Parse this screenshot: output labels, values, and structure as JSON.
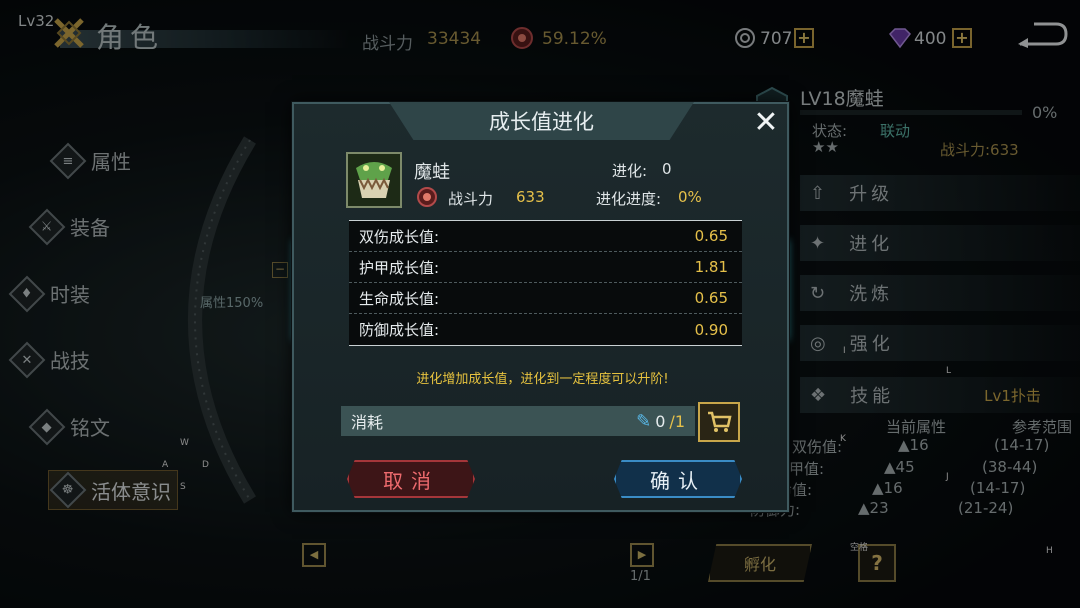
{
  "header": {
    "level": "Lv32",
    "title": "角色",
    "power_label": "战斗力",
    "power_value": "33434",
    "ratio_value": "59.12%",
    "coins": "707",
    "gems": "400",
    "plus_symbol": "+"
  },
  "left_menu": {
    "items": [
      {
        "label": "属性",
        "icon": "list-icon"
      },
      {
        "label": "装备",
        "icon": "sword-icon"
      },
      {
        "label": "时装",
        "icon": "outfit-icon"
      },
      {
        "label": "战技",
        "icon": "cross-swords-icon"
      },
      {
        "label": "铭文",
        "icon": "inscription-icon"
      },
      {
        "label": "活体意识",
        "icon": "bio-icon"
      }
    ],
    "attr_label": "属性150%",
    "minus_symbol": "−"
  },
  "right_panel": {
    "title": "LV18魔蛙",
    "progress_text": "0%",
    "progress": 0,
    "status_label": "状态:",
    "status_value": "联动",
    "stars": "★★",
    "power_text": "战斗力:633",
    "buttons": [
      "升级",
      "进化",
      "洗炼",
      "强化"
    ],
    "skill_label": "技能",
    "skill_value": "Lv1扑击",
    "col_current": "当前属性",
    "col_reference": "参考范围",
    "rows": [
      {
        "label": "双伤值:",
        "current": "16",
        "range": "(14-17)"
      },
      {
        "label": "护甲值:",
        "current": "45",
        "range": "(38-44)"
      },
      {
        "label": "生命值:",
        "current": "16",
        "range": "(14-17)"
      },
      {
        "label": "防御力:",
        "current": "23",
        "range": "(21-24)"
      }
    ]
  },
  "bottom": {
    "page": "1/1",
    "hatch_label": "孵化",
    "help": "?",
    "space_hint": "空格"
  },
  "key_hints": {
    "w": "W",
    "a": "A",
    "d": "D",
    "s": "S",
    "i": "I",
    "l": "L",
    "k": "K",
    "j": "J",
    "h": "H"
  },
  "modal": {
    "title": "成长值进化",
    "pet_name": "魔蛙",
    "evolve_label": "进化:",
    "evolve_value": "0",
    "power_label": "战斗力",
    "power_value": "633",
    "progress_label": "进化进度:",
    "progress_value": "0%",
    "stats": [
      {
        "label": "双伤成长值:",
        "value": "0.65"
      },
      {
        "label": "护甲成长值:",
        "value": "1.81"
      },
      {
        "label": "生命成长值:",
        "value": "0.65"
      },
      {
        "label": "防御成长值:",
        "value": "0.90"
      }
    ],
    "hint": "进化增加成长值，进化到一定程度可以升阶!",
    "cost_label": "消耗",
    "cost_have": "0",
    "cost_need": "/1",
    "cancel_label": "取消",
    "confirm_label": "确认"
  },
  "colors": {
    "gold": "#e5c04a",
    "cancel": "#ee6b6e",
    "confirm": "#3a8cc6",
    "teal": "#3aa8b8"
  }
}
